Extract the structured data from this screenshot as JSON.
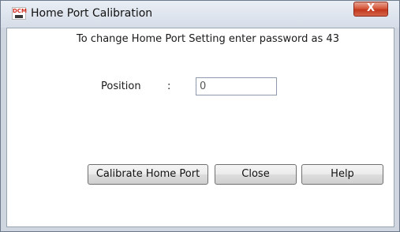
{
  "window": {
    "title": "Home Port Calibration",
    "app_icon_text": "DCM",
    "close_glyph": "X"
  },
  "dialog": {
    "instruction": "To change Home Port Setting enter password as 43",
    "position_label": "Position",
    "position_colon": ":",
    "position_value": "0"
  },
  "buttons": {
    "calibrate_label": "Calibrate Home Port",
    "close_label": "Close",
    "help_label": "Help"
  }
}
